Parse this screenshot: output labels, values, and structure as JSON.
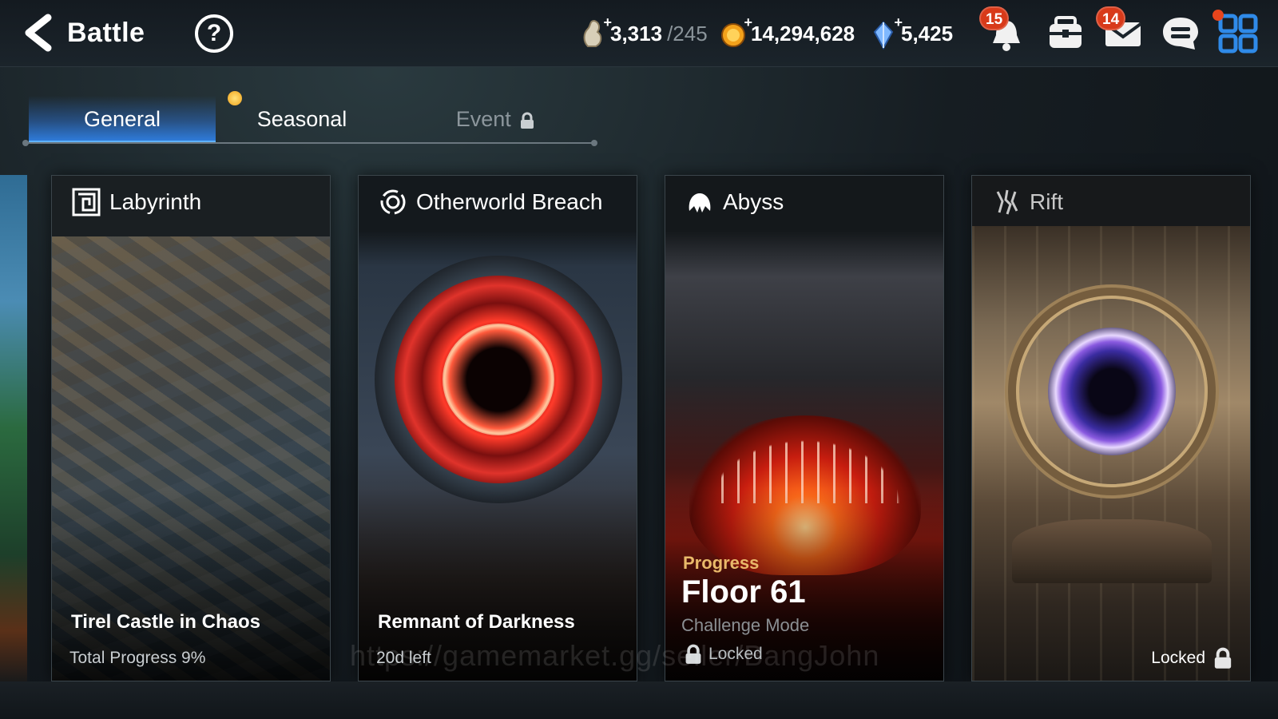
{
  "header": {
    "title": "Battle",
    "help_label": "?",
    "stamina": {
      "value": "3,313",
      "cap": "/245"
    },
    "gold": "14,294,628",
    "crystals": "5,425",
    "notifications_badge": "15",
    "mail_badge": "14"
  },
  "tabs": [
    {
      "label": "General",
      "active": true
    },
    {
      "label": "Seasonal",
      "active": false
    },
    {
      "label": "Event",
      "active": false,
      "locked": true
    }
  ],
  "cards": {
    "labyrinth": {
      "name": "Labyrinth",
      "title": "Tirel Castle in Chaos",
      "subtitle": "Total Progress 9%"
    },
    "otherworld": {
      "name": "Otherworld Breach",
      "title": "Remnant of Darkness",
      "subtitle": "20d left"
    },
    "abyss": {
      "name": "Abyss",
      "progress_label": "Progress",
      "floor": "Floor 61",
      "mode": "Challenge Mode",
      "status": "Locked"
    },
    "rift": {
      "name": "Rift",
      "status": "Locked"
    }
  },
  "watermark": "https://gamemarket.gg/seller/BangJohn",
  "colors": {
    "tab_active": "#2f7ee0",
    "badge": "#d83a1a",
    "progress_label": "#e9b96a",
    "menu_icon": "#2f8ae8"
  }
}
